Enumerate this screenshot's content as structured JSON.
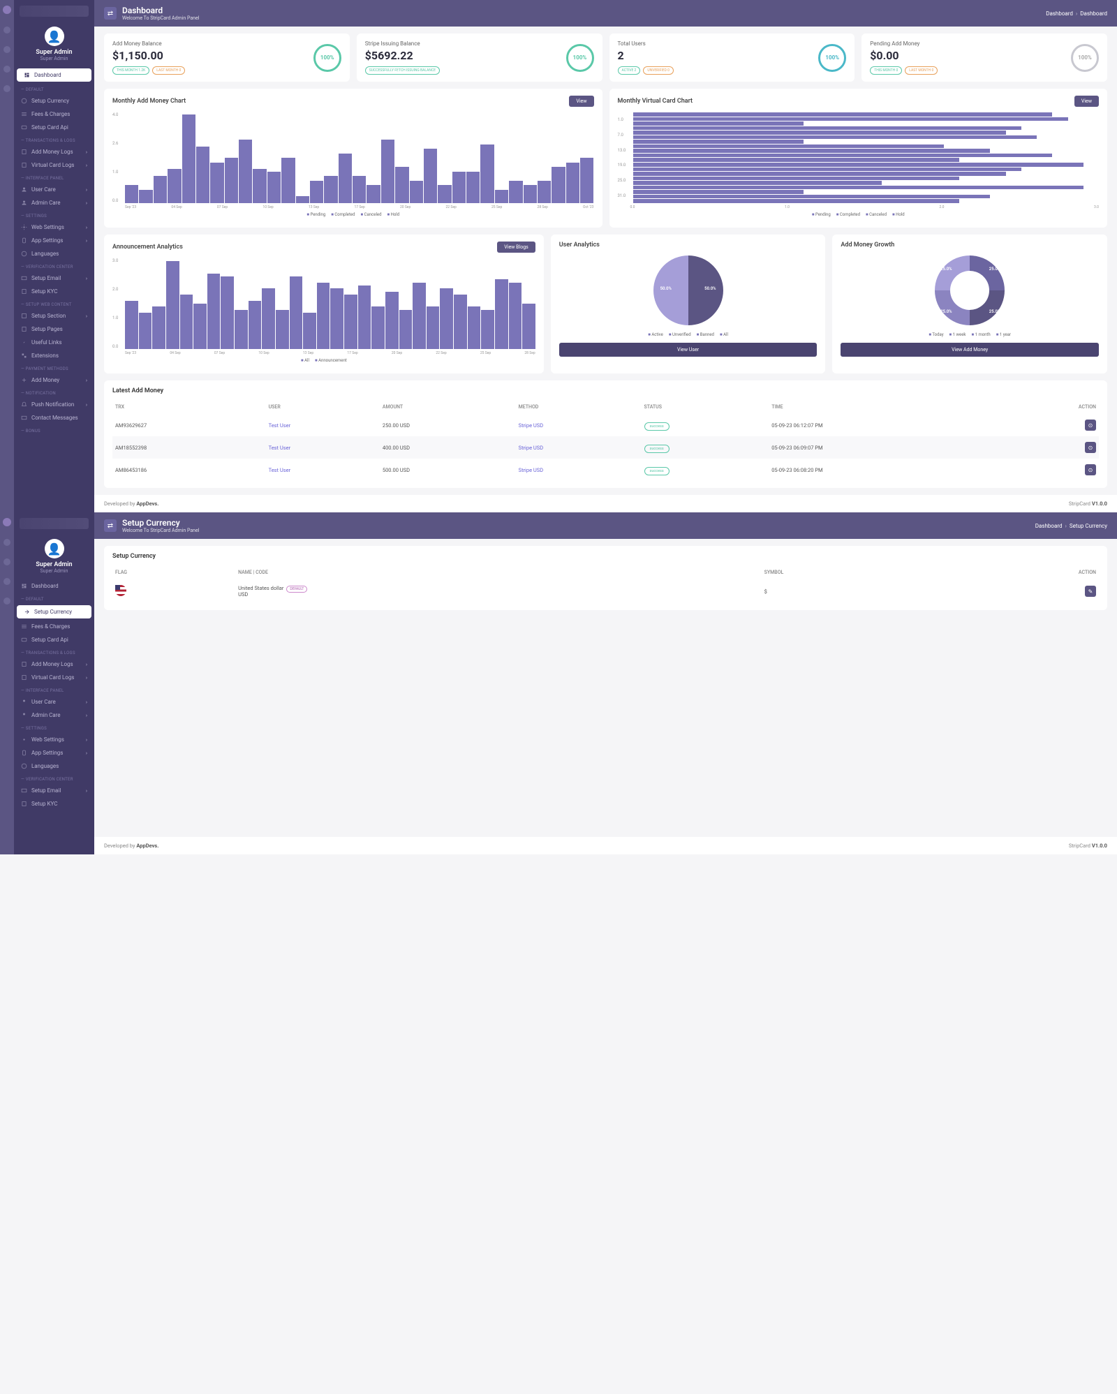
{
  "panel1": {
    "user": {
      "name": "Super Admin",
      "role": "Super Admin"
    },
    "nav": {
      "dashboard": "Dashboard",
      "sections": {
        "default": "DEFAULT",
        "trx": "TRANSACTIONS & LOGS",
        "iface": "INTERFACE PANEL",
        "settings": "SETTINGS",
        "verif": "VERIFICATION CENTER",
        "webcontent": "SETUP WEB CONTENT",
        "payment": "PAYMENT METHODS",
        "notif": "NOTIFICATION",
        "bonus": "BONUS"
      },
      "items": {
        "setupCurrency": "Setup Currency",
        "fees": "Fees & Charges",
        "cardApi": "Setup Card Api",
        "addMoneyLogs": "Add Money Logs",
        "virtualCardLogs": "Virtual Card Logs",
        "userCare": "User Care",
        "adminCare": "Admin Care",
        "webSettings": "Web Settings",
        "appSettings": "App Settings",
        "languages": "Languages",
        "setupEmail": "Setup Email",
        "setupKyc": "Setup KYC",
        "setupSection": "Setup Section",
        "setupPages": "Setup Pages",
        "usefulLinks": "Useful Links",
        "extensions": "Extensions",
        "addMoney": "Add Money",
        "pushNotif": "Push Notification",
        "contactMsg": "Contact Messages"
      }
    },
    "header": {
      "title": "Dashboard",
      "subtitle": "Welcome To StripCard Admin Panel",
      "crumb1": "Dashboard",
      "crumb2": "Dashboard"
    },
    "stats": [
      {
        "title": "Add Money Balance",
        "value": "$1,150.00",
        "b1": "THIS MONTH 1.2K",
        "b2": "LAST MONTH 0",
        "pct": "100%",
        "ring": "green"
      },
      {
        "title": "Stripe Issuing Balance",
        "value": "$5692.22",
        "b1": "SUCCESSFULLY FETCH ISSUING BALANCE",
        "b2": "",
        "pct": "100%",
        "ring": "green"
      },
      {
        "title": "Total Users",
        "value": "2",
        "b1": "ACTIVE 2",
        "b2": "UNVERIFIED 0",
        "pct": "100%",
        "ring": "teal"
      },
      {
        "title": "Pending Add Money",
        "value": "$0.00",
        "b1": "THIS MONTH 0",
        "b2": "LAST MONTH 0",
        "pct": "100%",
        "ring": "gray"
      }
    ],
    "chart1": {
      "title": "Monthly Add Money Chart",
      "btn": "View"
    },
    "chart2": {
      "title": "Monthly Virtual Card Chart",
      "btn": "View"
    },
    "chart3": {
      "title": "Announcement Analytics",
      "btn": "View Blogs"
    },
    "chart4": {
      "title": "User Analytics",
      "btn": "View User"
    },
    "chart5": {
      "title": "Add Money Growth",
      "btn": "View Add Money"
    },
    "legend": {
      "pending": "Pending",
      "completed": "Completed",
      "canceled": "Canceled",
      "hold": "Hold",
      "all": "All",
      "announcement": "Announcement",
      "active": "Active",
      "unverified": "Unverified",
      "banned": "Banned",
      "today": "Today",
      "week": "1 week",
      "month": "1 month",
      "year": "1 year"
    },
    "pie": {
      "p50a": "50.0%",
      "p50b": "50.0%",
      "p25": "25.0%"
    },
    "table": {
      "title": "Latest Add Money",
      "cols": {
        "trx": "TRX",
        "user": "USER",
        "amount": "AMOUNT",
        "method": "METHOD",
        "status": "STATUS",
        "time": "TIME",
        "action": "ACTION"
      },
      "rows": [
        {
          "trx": "AM93629627",
          "user": "Test User",
          "amount": "250.00 USD",
          "method": "Stripe USD",
          "status": "success",
          "time": "05-09-23 06:12:07 PM"
        },
        {
          "trx": "AM18552398",
          "user": "Test User",
          "amount": "400.00 USD",
          "method": "Stripe USD",
          "status": "success",
          "time": "05-09-23 06:09:07 PM"
        },
        {
          "trx": "AM86453186",
          "user": "Test User",
          "amount": "500.00 USD",
          "method": "Stripe USD",
          "status": "success",
          "time": "05-09-23 06:08:20 PM"
        }
      ]
    },
    "footer": {
      "dev": "Developed by ",
      "brand": "AppDevs.",
      "prod": "StripCard ",
      "ver": "V1.0.0"
    }
  },
  "panel2": {
    "header": {
      "title": "Setup Currency",
      "subtitle": "Welcome To StripCard Admin Panel",
      "crumb1": "Dashboard",
      "crumb2": "Setup Currency"
    },
    "table": {
      "title": "Setup Currency",
      "cols": {
        "flag": "FLAG",
        "name": "NAME | CODE",
        "symbol": "SYMBOL",
        "action": "ACTION"
      },
      "row": {
        "name": "United States dollar",
        "def": "DEFAULT",
        "code": "USD",
        "symbol": "$"
      }
    }
  },
  "chart_data": [
    {
      "type": "bar",
      "title": "Monthly Add Money Chart",
      "xlabel": "",
      "ylabel": "",
      "ylim": [
        0,
        4
      ],
      "categories": [
        "Sep '23",
        "04 Sep",
        "07 Sep",
        "10 Sep",
        "13 Sep",
        "17 Sep",
        "20 Sep",
        "22 Sep",
        "25 Sep",
        "28 Sep",
        "Oct '23"
      ],
      "series": [
        {
          "name": "Pending",
          "values": [
            0.8,
            0.6,
            1.2,
            1.5,
            3.9,
            2.5,
            1.8,
            2.0,
            2.8,
            1.5,
            1.4,
            2.0,
            0.3,
            1.0,
            1.2,
            2.2,
            1.2,
            0.8,
            2.8,
            1.6,
            1.0,
            2.4,
            0.8,
            1.4,
            1.4,
            2.6,
            0.6,
            1.0,
            0.8,
            1.0,
            1.6,
            1.8,
            2.0
          ]
        }
      ],
      "legend": [
        "Pending",
        "Completed",
        "Canceled",
        "Hold"
      ]
    },
    {
      "type": "bar",
      "orientation": "horizontal",
      "title": "Monthly Virtual Card Chart",
      "xlim": [
        0,
        3
      ],
      "categories": [
        "1.0",
        "7.0",
        "13.0",
        "19.0",
        "25.0",
        "31.0"
      ],
      "series": [
        {
          "name": "Pending",
          "values": [
            2.7,
            2.8,
            1.1,
            2.5,
            2.4,
            2.6,
            1.1,
            2.0,
            2.3,
            2.7,
            2.1,
            2.9,
            2.5,
            2.4,
            2.1,
            1.6,
            2.9,
            1.1,
            2.3,
            2.1
          ]
        }
      ],
      "legend": [
        "Pending",
        "Completed",
        "Canceled",
        "Hold"
      ]
    },
    {
      "type": "bar",
      "title": "Announcement Analytics",
      "ylim": [
        0,
        3
      ],
      "categories": [
        "Sep '23",
        "04 Sep",
        "07 Sep",
        "10 Sep",
        "13 Sep",
        "17 Sep",
        "20 Sep",
        "22 Sep",
        "25 Sep",
        "28 Sep"
      ],
      "series": [
        {
          "name": "All",
          "values": [
            1.6,
            1.2,
            1.4,
            2.9,
            1.8,
            1.5,
            2.5,
            2.4,
            1.3,
            1.6,
            2.0,
            1.3,
            2.4,
            1.2,
            2.2,
            2.0,
            1.8,
            2.1,
            1.4,
            1.9,
            1.3,
            2.2,
            1.4,
            2.0,
            1.8,
            1.4,
            1.3,
            2.3,
            2.2,
            1.5
          ]
        }
      ],
      "legend": [
        "All",
        "Announcement"
      ]
    },
    {
      "type": "pie",
      "title": "User Analytics",
      "series": [
        {
          "name": "Active",
          "value": 50.0
        },
        {
          "name": "Unverified",
          "value": 50.0
        }
      ],
      "legend": [
        "Active",
        "Unverified",
        "Banned",
        "All"
      ]
    },
    {
      "type": "pie",
      "title": "Add Money Growth",
      "donut": true,
      "series": [
        {
          "name": "Today",
          "value": 25.0
        },
        {
          "name": "1 week",
          "value": 25.0
        },
        {
          "name": "1 month",
          "value": 25.0
        },
        {
          "name": "1 year",
          "value": 25.0
        }
      ],
      "legend": [
        "Today",
        "1 week",
        "1 month",
        "1 year"
      ]
    }
  ]
}
